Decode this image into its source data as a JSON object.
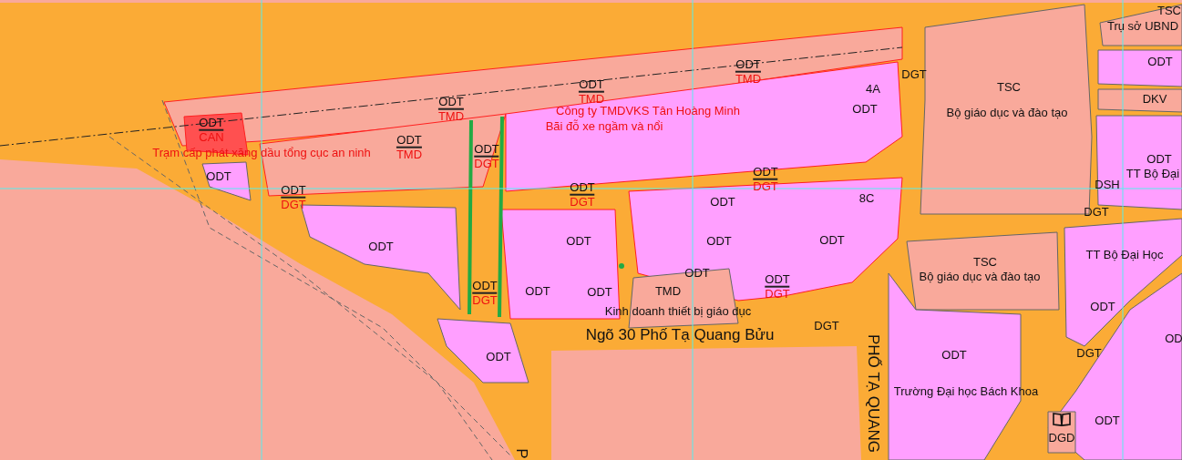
{
  "map": {
    "fraction_labels": [
      {
        "top": "ODT",
        "bottom": "CAN"
      },
      {
        "top": "ODT",
        "bottom": "TMD"
      },
      {
        "top": "ODT",
        "bottom": "TMD"
      },
      {
        "top": "ODT",
        "bottom": "TMD"
      },
      {
        "top": "ODT",
        "bottom": "TMD"
      },
      {
        "top": "ODT",
        "bottom": "DGT"
      },
      {
        "top": "ODT",
        "bottom": "DGT"
      },
      {
        "top": "ODT",
        "bottom": "DGT"
      },
      {
        "top": "ODT",
        "bottom": "DGT"
      },
      {
        "top": "ODT",
        "bottom": "DGT"
      },
      {
        "top": "ODT",
        "bottom": "DGT"
      }
    ],
    "labels": [
      {
        "text": "TSC",
        "kind": "code"
      },
      {
        "text": "Trụ sở UBND",
        "kind": "name"
      },
      {
        "text": "ODT",
        "kind": "code"
      },
      {
        "text": "DGT",
        "kind": "code"
      },
      {
        "text": "TSC",
        "kind": "code"
      },
      {
        "text": "Bộ giáo dục và đào tạo",
        "kind": "name"
      },
      {
        "text": "4A",
        "kind": "code"
      },
      {
        "text": "DKV",
        "kind": "code"
      },
      {
        "text": "ODT",
        "kind": "code"
      },
      {
        "text": "ODT",
        "kind": "code"
      },
      {
        "text": "TT Bộ Đại",
        "kind": "name"
      },
      {
        "text": "ODT",
        "kind": "code"
      },
      {
        "text": "DSH",
        "kind": "code"
      },
      {
        "text": "8C",
        "kind": "code"
      },
      {
        "text": "ODT",
        "kind": "code"
      },
      {
        "text": "DGT",
        "kind": "code"
      },
      {
        "text": "ODT",
        "kind": "code"
      },
      {
        "text": "ODT",
        "kind": "code"
      },
      {
        "text": "ODT",
        "kind": "code"
      },
      {
        "text": "ODT",
        "kind": "code"
      },
      {
        "text": "TSC",
        "kind": "code"
      },
      {
        "text": "TT Bộ Đại Học",
        "kind": "name"
      },
      {
        "text": "Bộ giáo dục và đào tạo",
        "kind": "name"
      },
      {
        "text": "ODT",
        "kind": "code"
      },
      {
        "text": "ODT",
        "kind": "code"
      },
      {
        "text": "ODT",
        "kind": "code"
      },
      {
        "text": "TMD",
        "kind": "code"
      },
      {
        "text": "ODT",
        "kind": "code"
      },
      {
        "text": "Kinh doanh thiết bị giáo dục",
        "kind": "name"
      },
      {
        "text": "DGT",
        "kind": "code"
      },
      {
        "text": "Ngõ 30 Phố Tạ Quang Bửu",
        "kind": "street"
      },
      {
        "text": "OD",
        "kind": "code"
      },
      {
        "text": "ODT",
        "kind": "code"
      },
      {
        "text": "DGT",
        "kind": "code"
      },
      {
        "text": "ODT",
        "kind": "code"
      },
      {
        "text": "Trường Đại học Bách Khoa",
        "kind": "name"
      },
      {
        "text": "PHỐ TẠ QUANG",
        "kind": "street-vertical"
      },
      {
        "text": "ODT",
        "kind": "code"
      },
      {
        "text": "DGD",
        "kind": "code"
      },
      {
        "text": "P",
        "kind": "street-vertical"
      },
      {
        "text": "Trạm cấp phát xăng dầu tổng cục an ninh",
        "kind": "note"
      },
      {
        "text": "Công ty TMDVKS Tân Hoàng Minh",
        "kind": "note"
      },
      {
        "text": "Bãi đỗ xe ngầm và nổi",
        "kind": "note"
      }
    ]
  }
}
